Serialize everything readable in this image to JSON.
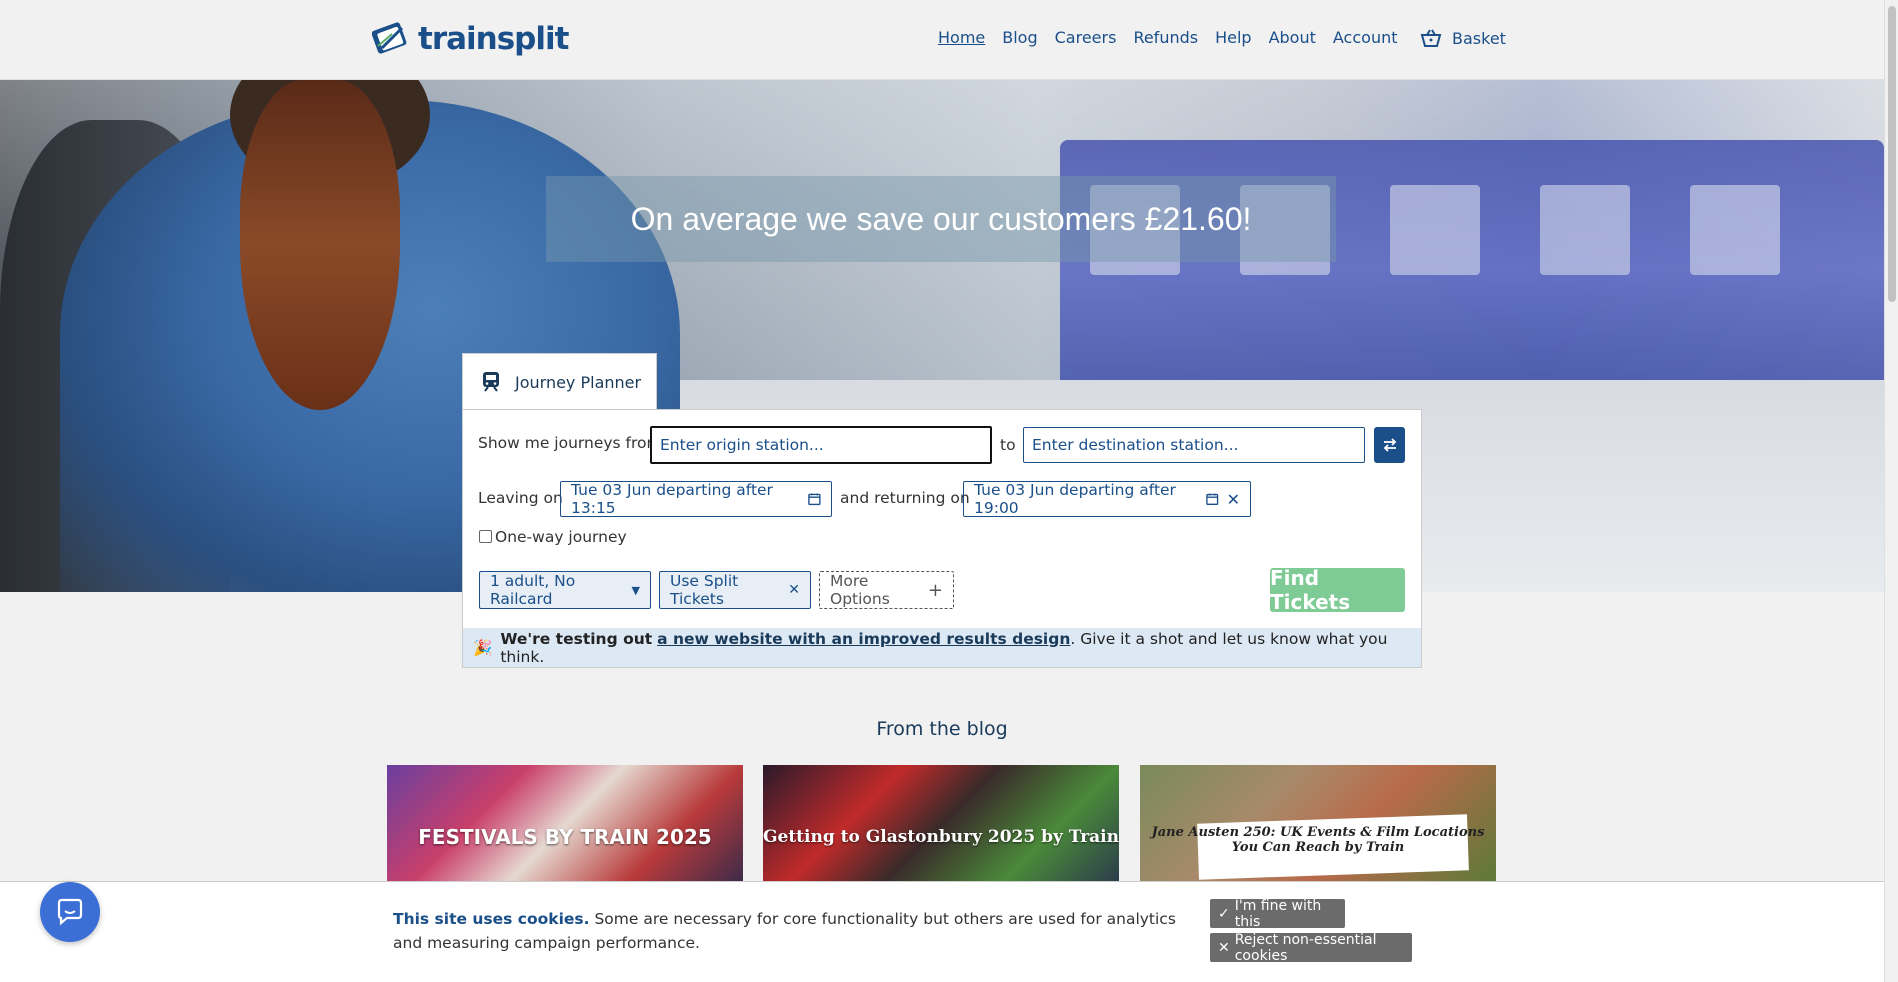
{
  "header": {
    "logo_text": "trainsplit",
    "nav": [
      {
        "label": "Home"
      },
      {
        "label": "Blog"
      },
      {
        "label": "Careers"
      },
      {
        "label": "Refunds"
      },
      {
        "label": "Help"
      },
      {
        "label": "About"
      },
      {
        "label": "Account"
      }
    ],
    "basket_label": "Basket"
  },
  "hero": {
    "headline": "On average we save our customers £21.60!"
  },
  "journey_planner": {
    "tab_label": "Journey Planner",
    "from_label": "Show me journeys from",
    "origin_placeholder": "Enter origin station...",
    "to_label": "to",
    "destination_placeholder": "Enter destination station...",
    "leaving_label": "Leaving on",
    "leaving_value": "Tue 03 Jun departing after 13:15",
    "returning_label": "and returning on",
    "returning_value": "Tue 03 Jun departing after 19:00",
    "one_way_label": "One-way journey",
    "passengers": "1 adult, No Railcard",
    "split_tickets": "Use Split Tickets",
    "more_options": "More Options",
    "find_button": "Find Tickets"
  },
  "notice": {
    "emoji": "🎉",
    "lead": "We're testing out",
    "link": "a new website with an improved results design",
    "tail": ". Give it a shot and let us know what you think."
  },
  "blog": {
    "title": "From the blog",
    "cards": [
      {
        "caption": "FESTIVALS BY TRAIN 2025"
      },
      {
        "caption": "Getting to Glastonbury 2025 by Train"
      },
      {
        "caption": "Jane Austen 250: UK Events & Film Locations You Can Reach by Train"
      }
    ]
  },
  "cookie": {
    "heading": "This site uses cookies.",
    "body": "Some are necessary for core functionality but others are used for analytics and measuring campaign performance.",
    "accept": "I'm fine with this",
    "reject": "Reject non-essential cookies"
  },
  "colors": {
    "brand": "#1a4f8a",
    "find_button": "#7ecb95",
    "notice_bg": "#dce9f5",
    "cookie_button": "#6b6b6b",
    "chat": "#3b6fd6"
  }
}
